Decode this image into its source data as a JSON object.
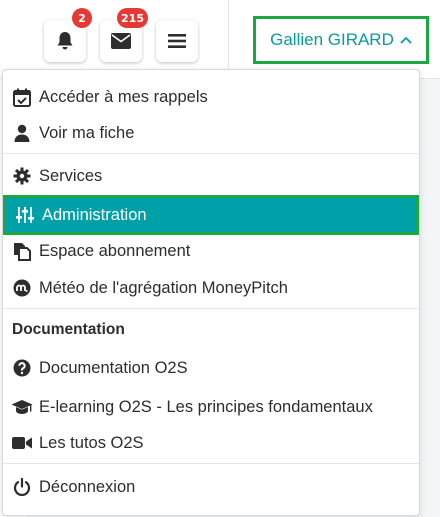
{
  "notifications": {
    "icon": "bell-icon",
    "count": "2"
  },
  "messages": {
    "icon": "envelope-icon",
    "count": "215"
  },
  "menu_button": {
    "icon": "hamburger-icon"
  },
  "user": {
    "name": "Gallien GIRARD",
    "icon": "chevron-up-icon"
  },
  "menu": {
    "items": [
      {
        "label": "Accéder à mes rappels",
        "icon": "calendar-check-icon"
      },
      {
        "label": "Voir ma fiche",
        "icon": "user-icon"
      },
      {
        "label": "Services",
        "icon": "gear-icon"
      },
      {
        "label": "Administration",
        "icon": "sliders-icon"
      },
      {
        "label": "Espace abonnement",
        "icon": "copy-icon"
      },
      {
        "label": "Météo de l'agrégation MoneyPitch",
        "icon": "moneypitch-icon"
      }
    ],
    "documentation_title": "Documentation",
    "doc_items": [
      {
        "label": "Documentation O2S",
        "icon": "question-circle-icon"
      },
      {
        "label": "E-learning O2S - Les principes fondamentaux",
        "icon": "graduation-cap-icon"
      },
      {
        "label": "Les tutos O2S",
        "icon": "video-camera-icon"
      }
    ],
    "logout": {
      "label": "Déconnexion",
      "icon": "power-icon"
    }
  },
  "colors": {
    "accent": "#00a0a8",
    "highlight_border": "#1fa644",
    "badge": "#e53935",
    "user_text": "#0a9aa1"
  }
}
